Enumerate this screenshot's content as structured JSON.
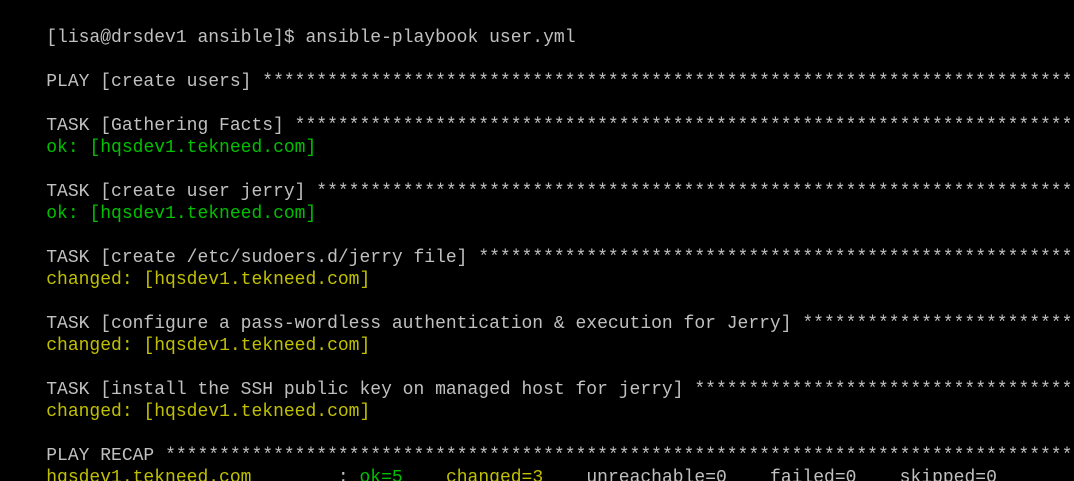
{
  "colors": {
    "background": "#000000",
    "default_text": "#c0c0c0",
    "ok": "#00c000",
    "changed": "#c0c000"
  },
  "prompt": {
    "text": "[lisa@drsdev1 ansible]$ ansible-playbook user.yml"
  },
  "play": {
    "header": "PLAY [create users]"
  },
  "tasks": [
    {
      "header": "TASK [Gathering Facts]",
      "result_status": "ok:",
      "result_host": "[hqsdev1.tekneed.com]"
    },
    {
      "header": "TASK [create user jerry]",
      "result_status": "ok:",
      "result_host": "[hqsdev1.tekneed.com]"
    },
    {
      "header": "TASK [create /etc/sudoers.d/jerry file]",
      "result_status": "changed:",
      "result_host": "[hqsdev1.tekneed.com]"
    },
    {
      "header": "TASK [configure a pass-wordless authentication & execution for Jerry]",
      "result_status": "changed:",
      "result_host": "[hqsdev1.tekneed.com]"
    },
    {
      "header": "TASK [install the SSH public key on managed host for jerry]",
      "result_status": "changed:",
      "result_host": "[hqsdev1.tekneed.com]"
    }
  ],
  "recap": {
    "header": "PLAY RECAP",
    "host": "hqsdev1.tekneed.com",
    "separator": ":",
    "ok": "ok=5",
    "changed": "changed=3",
    "unreachable": "unreachable=0",
    "failed": "failed=0",
    "skipped": "skipped=0"
  }
}
